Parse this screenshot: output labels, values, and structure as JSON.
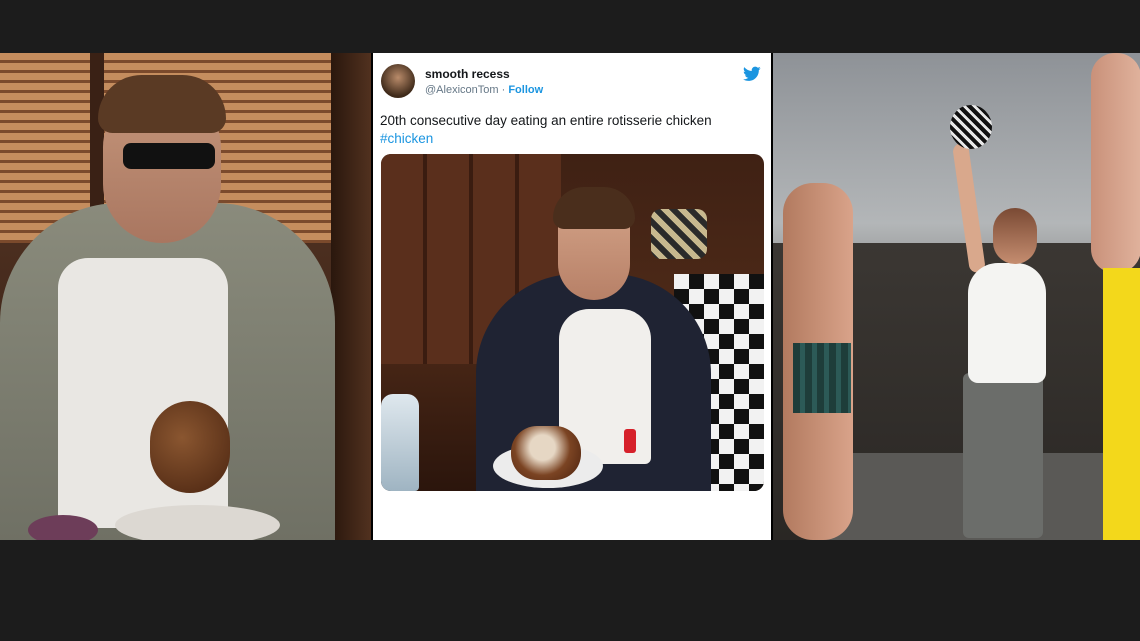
{
  "tweet": {
    "display_name": "smooth recess",
    "handle": "@AlexiconTom",
    "separator": "·",
    "follow_label": "Follow",
    "text": "20th consecutive day eating an entire rotisserie chicken",
    "hashtag": "#chicken",
    "bird_icon": "twitter-bird-icon",
    "accent_color": "#1b95e0"
  }
}
